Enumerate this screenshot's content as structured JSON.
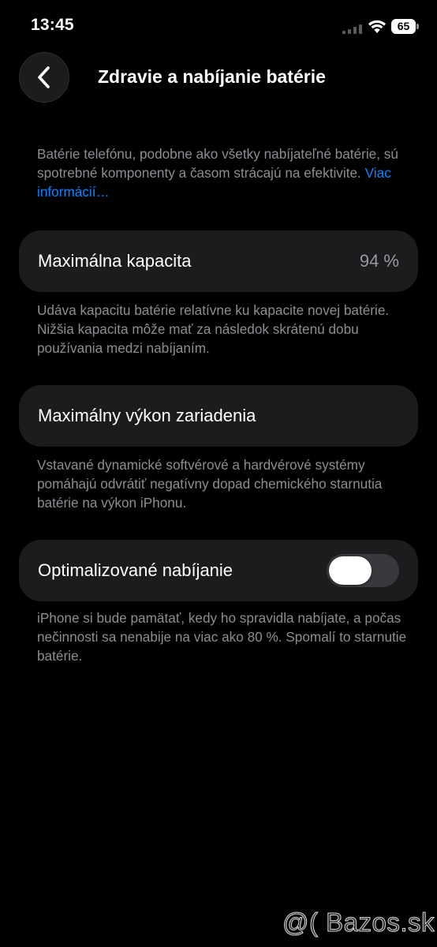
{
  "status_bar": {
    "time": "13:45",
    "battery_level": "65"
  },
  "nav": {
    "title": "Zdravie a nabíjanie batérie"
  },
  "intro": {
    "text": "Batérie telefónu, podobne ako všetky nabíjateľné batérie, sú spotrebné komponenty a časom strácajú na efektivite.",
    "link": "Viac informácií…"
  },
  "max_capacity": {
    "label": "Maximálna kapacita",
    "value": "94 %",
    "note": "Udáva kapacitu batérie relatívne ku kapacite novej batérie. Nižšia kapacita môže mať za následok skrátenú dobu používania medzi nabíjaním."
  },
  "peak_performance": {
    "label": "Maximálny výkon zariadenia",
    "note": "Vstavané dynamické softvérové a hardvérové systémy pomáhajú odvrátiť negatívny dopad chemického starnutia batérie na výkon iPhonu."
  },
  "optimized_charging": {
    "label": "Optimalizované nabíjanie",
    "enabled": false,
    "note": "iPhone si bude pamätať, kedy ho spravidla nabíjate, a počas nečinnosti sa nenabije na viac ako 80 %. Spomalí to starnutie batérie."
  },
  "watermark": "@( Bazos.sk",
  "icons": {
    "back": "chevron-left-icon",
    "signal": "cellular-signal-icon",
    "wifi": "wifi-icon",
    "battery": "battery-icon"
  },
  "colors": {
    "background": "#000000",
    "cell": "#1c1c1e",
    "link": "#0a84ff",
    "secondary_text": "#8d8d93",
    "toggle_off": "#39393d"
  }
}
